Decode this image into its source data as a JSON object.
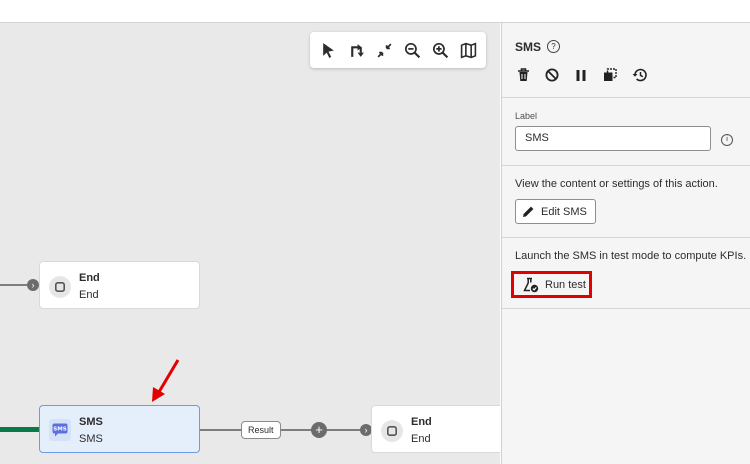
{
  "canvas": {
    "toolbar": {
      "icons": [
        "cursor-icon",
        "reroute-icon",
        "collapse-icon",
        "zoom-out-icon",
        "zoom-in-icon",
        "map-icon"
      ]
    },
    "nodes": {
      "end_top": {
        "title": "End",
        "subtitle": "End"
      },
      "sms": {
        "title": "SMS",
        "subtitle": "SMS",
        "icon_text": "SMS"
      },
      "end_bottom": {
        "title": "End",
        "subtitle": "End"
      }
    },
    "result_tag": "Result",
    "plus": "+"
  },
  "panel": {
    "title": "SMS",
    "help_glyph": "?",
    "actions": [
      "delete-icon",
      "disable-icon",
      "pause-icon",
      "copy-icon",
      "history-icon"
    ],
    "label_caption": "Label",
    "label_value": "SMS",
    "info_glyph": "i",
    "content_text": "View the content or settings of this action.",
    "edit_button": "Edit SMS",
    "test_text": "Launch the SMS in test mode to compute KPIs.",
    "run_test_button": "Run test"
  },
  "colors": {
    "canvas_bg": "#e9e9e9",
    "selected_node": "#e5effc",
    "highlight": "#e40000",
    "pointer_arrow": "#e40000",
    "entry_line": "#0b7a4b"
  }
}
